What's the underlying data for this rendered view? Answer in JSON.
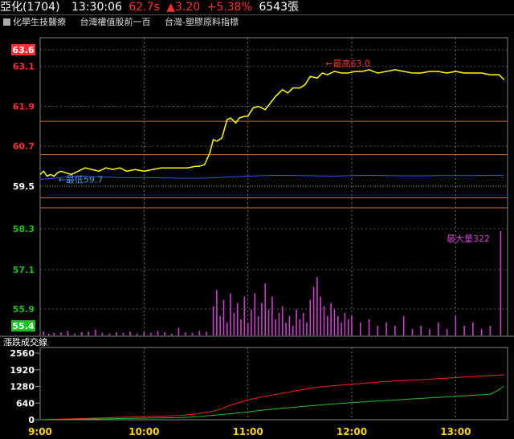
{
  "header": {
    "name": "亞化(1704)",
    "time": "13:30:06",
    "price": "62.7s",
    "change": "▲3.20",
    "percent": "+5.38%",
    "volume": "6543張"
  },
  "toolbar": {
    "items": [
      "化學生技醫療",
      "台灣權值股前一百",
      "台灣-塑膠原料指標"
    ]
  },
  "colors": {
    "up": "#ff3030",
    "price_line": "#ffff00",
    "avg_line": "#3050ff",
    "volume_bar": "#cc40cc",
    "axis_text": "#ffd700",
    "low_annotation": "#3aa0ff",
    "high_annotation": "#ff3030",
    "maxvol_annotation": "#cc40cc",
    "cum_red": "#ff2020",
    "cum_green": "#20c020"
  },
  "chart_data": [
    {
      "type": "line",
      "title": "",
      "y_ticks": [
        {
          "value": 63.6,
          "label": "63.6",
          "style": "box-red"
        },
        {
          "value": 63.1,
          "label": "63.1",
          "style": "red"
        },
        {
          "value": 61.9,
          "label": "61.9",
          "style": "red"
        },
        {
          "value": 60.7,
          "label": "60.7",
          "style": "red"
        },
        {
          "value": 59.5,
          "label": "59.5",
          "style": "white"
        }
      ],
      "ylim": [
        59.5,
        63.6
      ],
      "x_ticks": [
        "9:00",
        "10:00",
        "11:00",
        "12:00",
        "13:00"
      ],
      "xlim_minutes": [
        0,
        270
      ],
      "reference_price": 59.5,
      "series": [
        {
          "key": "price",
          "x": [
            0,
            2,
            4,
            6,
            8,
            10,
            12,
            15,
            18,
            22,
            26,
            30,
            34,
            38,
            42,
            46,
            50,
            55,
            60,
            65,
            70,
            75,
            80,
            85,
            90,
            92,
            95,
            98,
            100,
            102,
            105,
            108,
            110,
            113,
            115,
            118,
            120,
            123,
            126,
            130,
            133,
            136,
            140,
            143,
            146,
            150,
            153,
            156,
            160,
            163,
            166,
            170,
            174,
            178,
            182,
            186,
            190,
            195,
            200,
            205,
            210,
            215,
            220,
            225,
            230,
            235,
            240,
            245,
            250,
            255,
            260,
            265,
            268
          ],
          "y": [
            59.85,
            59.95,
            59.8,
            59.85,
            59.8,
            59.9,
            59.95,
            59.9,
            59.85,
            59.95,
            60.05,
            60.0,
            59.95,
            60.05,
            60.0,
            60.05,
            59.95,
            60.0,
            59.95,
            60.0,
            60.05,
            60.05,
            60.05,
            60.05,
            60.1,
            60.1,
            60.15,
            60.5,
            60.9,
            60.85,
            60.95,
            61.5,
            61.55,
            61.4,
            61.55,
            61.6,
            61.6,
            61.85,
            61.9,
            61.8,
            62.0,
            62.2,
            62.4,
            62.3,
            62.45,
            62.45,
            62.55,
            62.8,
            62.75,
            62.9,
            62.85,
            62.95,
            62.9,
            62.9,
            62.95,
            62.95,
            63.0,
            62.9,
            62.95,
            63.0,
            62.95,
            62.9,
            62.9,
            62.95,
            62.95,
            62.9,
            62.95,
            62.9,
            62.9,
            62.9,
            62.85,
            62.85,
            62.7
          ]
        },
        {
          "key": "average",
          "x": [
            0,
            10,
            20,
            30,
            40,
            50,
            60,
            70,
            80,
            90,
            100,
            110,
            120,
            130,
            140,
            150,
            160,
            170,
            180,
            190,
            200,
            210,
            220,
            230,
            240,
            250,
            260,
            268
          ],
          "y": [
            59.7,
            59.75,
            59.8,
            59.78,
            59.77,
            59.75,
            59.76,
            59.75,
            59.74,
            59.74,
            59.75,
            59.78,
            59.8,
            59.82,
            59.83,
            59.82,
            59.81,
            59.8,
            59.82,
            59.83,
            59.82,
            59.81,
            59.81,
            59.82,
            59.82,
            59.82,
            59.83,
            59.83
          ]
        }
      ],
      "reference_lines": [
        61.45,
        60.45,
        59.15,
        58.85
      ],
      "annotations": [
        {
          "label": "←最高63.0",
          "x": 163,
          "y": 63.0
        },
        {
          "label": "←最低59.7",
          "x": 4,
          "y": 59.7
        }
      ]
    },
    {
      "type": "bar",
      "title": "",
      "y_ticks": [
        {
          "value": 58.3,
          "label": "58.3",
          "style": "green"
        },
        {
          "value": 57.1,
          "label": "57.1",
          "style": "green"
        },
        {
          "value": 55.9,
          "label": "55.9",
          "style": "green"
        },
        {
          "value": 55.4,
          "label": "55.4",
          "style": "box-green"
        }
      ],
      "ylim_volume": [
        0,
        322
      ],
      "max_volume_label": "最大量322",
      "volume_x": [
        2,
        5,
        8,
        12,
        16,
        20,
        24,
        28,
        32,
        36,
        40,
        44,
        48,
        52,
        56,
        60,
        64,
        68,
        72,
        76,
        80,
        84,
        88,
        92,
        96,
        100,
        102,
        104,
        106,
        108,
        110,
        112,
        114,
        116,
        118,
        120,
        122,
        124,
        126,
        128,
        130,
        132,
        134,
        136,
        138,
        140,
        142,
        144,
        146,
        148,
        150,
        152,
        154,
        156,
        158,
        160,
        162,
        164,
        166,
        168,
        170,
        172,
        174,
        176,
        178,
        180,
        185,
        190,
        195,
        200,
        205,
        210,
        215,
        220,
        225,
        230,
        235,
        240,
        245,
        250,
        255,
        260,
        266
      ],
      "volume_values": [
        12,
        6,
        8,
        10,
        14,
        6,
        10,
        12,
        18,
        8,
        6,
        10,
        8,
        12,
        6,
        10,
        8,
        14,
        10,
        6,
        24,
        10,
        8,
        14,
        12,
        90,
        140,
        60,
        110,
        40,
        130,
        70,
        100,
        50,
        120,
        40,
        80,
        130,
        60,
        100,
        160,
        80,
        120,
        50,
        70,
        90,
        40,
        60,
        30,
        80,
        50,
        70,
        40,
        110,
        150,
        180,
        120,
        90,
        60,
        100,
        80,
        60,
        40,
        70,
        50,
        60,
        40,
        50,
        30,
        40,
        30,
        60,
        20,
        30,
        20,
        40,
        20,
        60,
        30,
        40,
        20,
        30,
        322
      ]
    },
    {
      "type": "line",
      "title": "漲跌成交線",
      "y_ticks": [
        {
          "value": 2560,
          "label": "2560"
        },
        {
          "value": 1920,
          "label": "1920"
        },
        {
          "value": 1280,
          "label": "1280"
        },
        {
          "value": 640,
          "label": "640"
        },
        {
          "value": 0,
          "label": "0"
        }
      ],
      "ylim": [
        0,
        2560
      ],
      "series": [
        {
          "key": "up_volume",
          "x": [
            0,
            20,
            40,
            60,
            80,
            90,
            100,
            105,
            110,
            120,
            130,
            140,
            150,
            160,
            170,
            180,
            190,
            200,
            210,
            220,
            230,
            240,
            250,
            260,
            268
          ],
          "y": [
            0,
            40,
            80,
            120,
            160,
            220,
            330,
            430,
            560,
            760,
            900,
            1020,
            1140,
            1250,
            1310,
            1360,
            1420,
            1470,
            1510,
            1540,
            1580,
            1620,
            1660,
            1700,
            1720
          ]
        },
        {
          "key": "down_volume",
          "x": [
            0,
            20,
            40,
            60,
            80,
            90,
            100,
            110,
            120,
            130,
            140,
            150,
            160,
            170,
            180,
            190,
            200,
            210,
            220,
            230,
            240,
            250,
            260,
            265,
            268
          ],
          "y": [
            0,
            20,
            40,
            60,
            80,
            110,
            170,
            230,
            300,
            380,
            440,
            500,
            560,
            610,
            660,
            700,
            740,
            780,
            820,
            860,
            900,
            940,
            980,
            1150,
            1300
          ]
        }
      ]
    }
  ]
}
